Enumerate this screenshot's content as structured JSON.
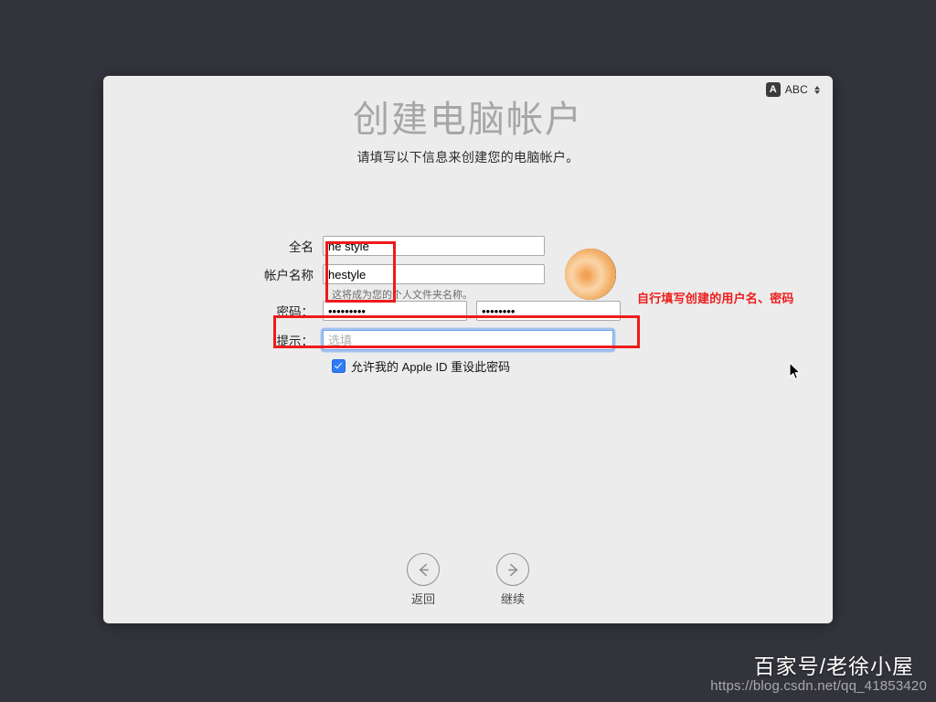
{
  "window": {
    "title": "创建电脑帐户",
    "subtitle": "请填写以下信息来创建您的电脑帐户。"
  },
  "input_source": {
    "badge": "A",
    "label": "ABC",
    "icon_up": "chevron-up-icon",
    "icon_down": "chevron-down-icon"
  },
  "form": {
    "fullname": {
      "label": "全名",
      "value": "he style",
      "placeholder": ""
    },
    "accountname": {
      "label": "帐户名称",
      "value": "hestyle",
      "placeholder": "",
      "help": "这将成为您的个人文件夹名称。"
    },
    "password": {
      "label": "密码：",
      "value": "•••••••••",
      "placeholder": "",
      "verify_value": "••••••••",
      "verify_placeholder": ""
    },
    "hint": {
      "label": "提示：",
      "value": "",
      "placeholder": "选填",
      "focused": true
    },
    "apple_id_reset": {
      "label": "允许我的 Apple ID 重设此密码",
      "checked": true
    },
    "avatar": {
      "name": "user-avatar-rose"
    }
  },
  "annotations": {
    "note": "自行填写创建的用户名、密码",
    "color": "#ee1b1b",
    "boxes": [
      {
        "name": "username-fields-highlight"
      },
      {
        "name": "password-fields-highlight"
      }
    ]
  },
  "navigation": {
    "back": {
      "label": "返回",
      "icon": "arrow-left-icon"
    },
    "continue": {
      "label": "继续",
      "icon": "arrow-right-icon"
    }
  },
  "watermarks": {
    "brand": "百家号/老徐小屋",
    "url": "https://blog.csdn.net/qq_41853420"
  },
  "colors": {
    "desktop": "#32333b",
    "window": "#ececec",
    "title": "#a6a6a6",
    "accent": "#2f7cf6",
    "annotation": "#ee1b1b"
  }
}
